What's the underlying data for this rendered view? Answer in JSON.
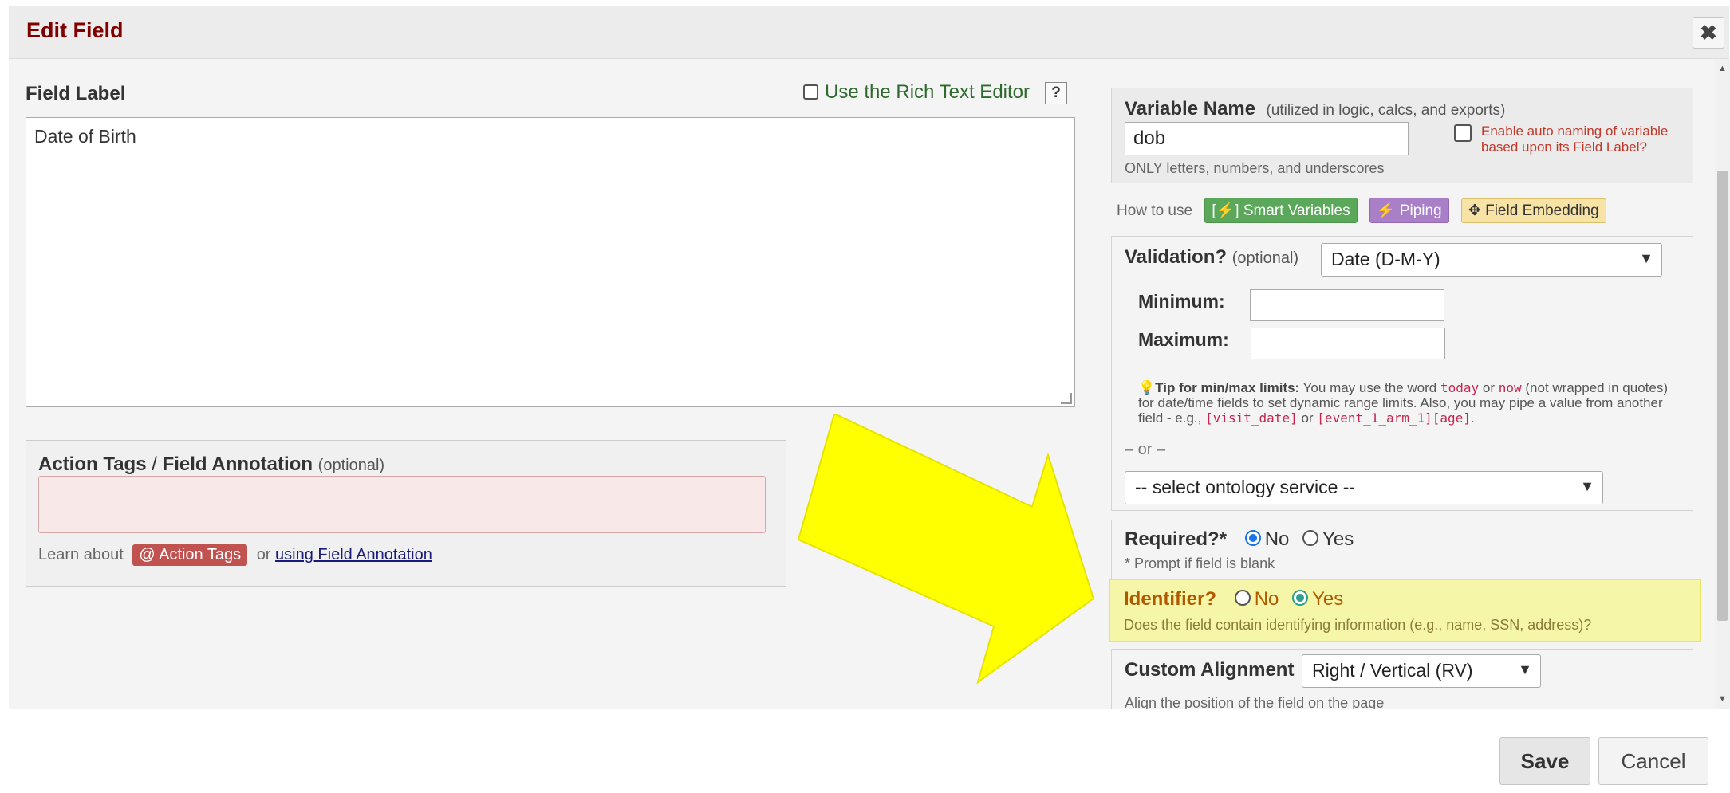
{
  "dialog": {
    "title": "Edit Field",
    "close_label": "✖"
  },
  "field_label": {
    "header": "Field Label",
    "rich_text_label": "Use the Rich Text Editor",
    "help_label": "?",
    "value": "Date of Birth"
  },
  "action_tags": {
    "header_bold1": "Action Tags",
    "sep": " / ",
    "header_bold2": "Field Annotation",
    "optional": "(optional)",
    "learn_about": "Learn about",
    "tag_button": "@ Action Tags",
    "or": "or",
    "annotation_link": "using Field Annotation"
  },
  "variable": {
    "header": "Variable Name",
    "sub": "(utilized in logic, calcs, and exports)",
    "value": "dob",
    "note": "ONLY letters, numbers, and underscores",
    "auto_naming": "Enable auto naming of variable based upon its Field Label?"
  },
  "how_to": {
    "label": "How to use",
    "smart_variables": "[⚡] Smart Variables",
    "piping": "⚡ Piping",
    "field_embedding": "✥ Field Embedding"
  },
  "validation": {
    "header": "Validation?",
    "optional": "(optional)",
    "selected": "Date (D-M-Y)",
    "min_label": "Minimum:",
    "max_label": "Maximum:",
    "tip_bold": "Tip for min/max limits:",
    "tip_1": "You may use the word",
    "tip_today": "today",
    "tip_or": "or",
    "tip_now": "now",
    "tip_2": "(not wrapped in quotes) for date/time fields to set dynamic range limits. Also, you may pipe a value from another field - e.g.,",
    "tip_ex1": "[visit_date]",
    "tip_or2": "or",
    "tip_ex2": "[event_1_arm_1][age]",
    "tip_end": ".",
    "or_line": "– or –",
    "ontology": "-- select ontology service --"
  },
  "required": {
    "header": "Required?*",
    "no": "No",
    "yes": "Yes",
    "selected": "No",
    "note": "* Prompt if field is blank"
  },
  "identifier": {
    "header": "Identifier?",
    "no": "No",
    "yes": "Yes",
    "selected": "Yes",
    "note": "Does the field contain identifying information (e.g., name, SSN, address)?"
  },
  "alignment": {
    "header": "Custom Alignment",
    "selected": "Right / Vertical (RV)",
    "note": "Align the position of the field on the page"
  },
  "footer": {
    "save": "Save",
    "cancel": "Cancel"
  },
  "colors": {
    "title": "#800000",
    "highlight": "#f6f6a8",
    "arrow": "#ffff00"
  }
}
